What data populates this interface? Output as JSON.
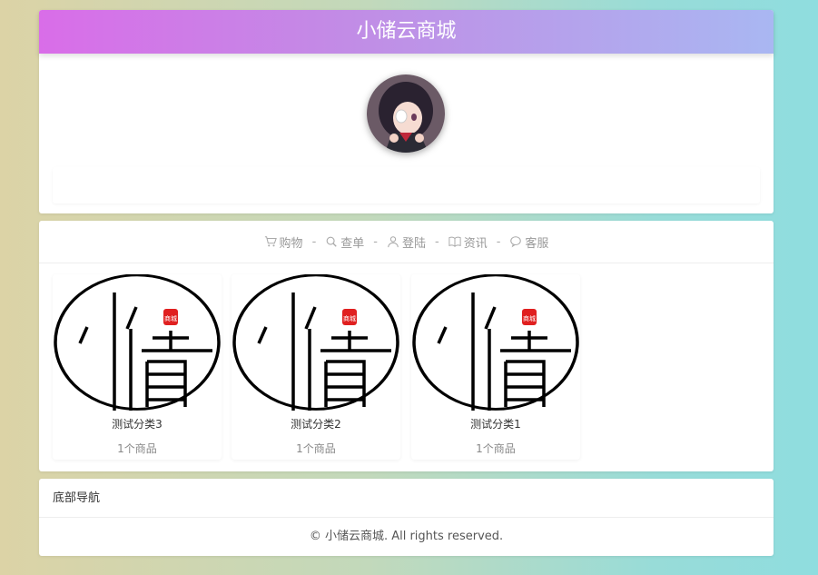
{
  "header": {
    "title": "小储云商城"
  },
  "nav": {
    "items": [
      {
        "label": "购物",
        "icon": "cart-icon"
      },
      {
        "label": "查单",
        "icon": "search-icon"
      },
      {
        "label": "登陆",
        "icon": "user-icon"
      },
      {
        "label": "资讯",
        "icon": "book-icon"
      },
      {
        "label": "客服",
        "icon": "chat-icon"
      }
    ],
    "separator": "-"
  },
  "products": [
    {
      "name": "测试分类3",
      "count": "1个商品",
      "logo_char": "储",
      "seal_text": "商城"
    },
    {
      "name": "测试分类2",
      "count": "1个商品",
      "logo_char": "储",
      "seal_text": "商城"
    },
    {
      "name": "测试分类1",
      "count": "1个商品",
      "logo_char": "储",
      "seal_text": "商城"
    }
  ],
  "footer": {
    "title": "底部导航",
    "copyright": "© 小储云商城. All rights reserved."
  },
  "colors": {
    "seal": "#e02020",
    "nav_text": "#999999"
  }
}
